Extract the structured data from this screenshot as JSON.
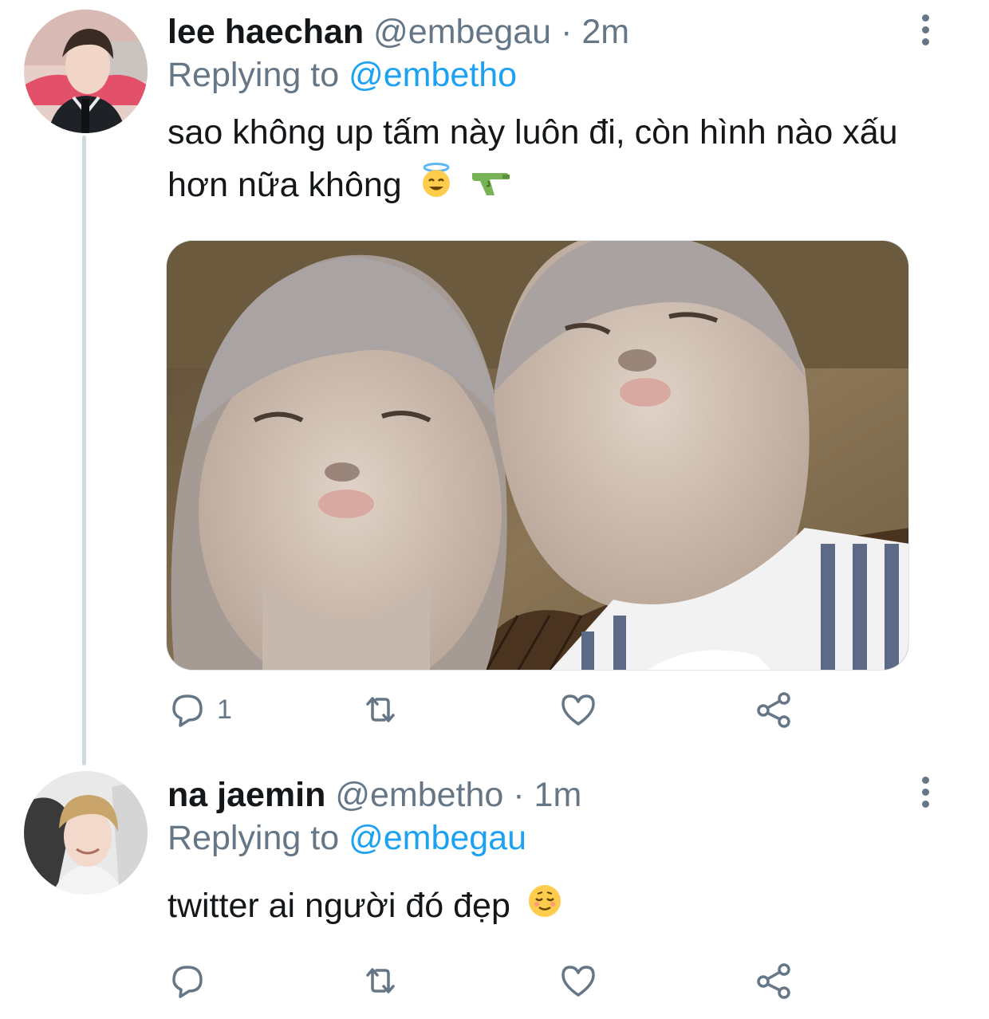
{
  "colors": {
    "text": "#14171a",
    "secondary": "#657786",
    "link": "#1da1f2",
    "line": "#cfd9de"
  },
  "tweets": [
    {
      "name": "lee haechan",
      "handle": "@embegau",
      "dot": "·",
      "time": "2m",
      "replying_prefix": "Replying to",
      "replying_to": "@embetho",
      "text": "sao không up tấm này luôn đi, còn hình nào xấu hơn nữa không",
      "emojis": [
        "smiling-face-with-halo",
        "water-pistol"
      ],
      "has_media": true,
      "actions": {
        "reply_count": "1",
        "retweet_count": "",
        "like_count": ""
      }
    },
    {
      "name": "na jaemin",
      "handle": "@embetho",
      "dot": "·",
      "time": "1m",
      "replying_prefix": "Replying to",
      "replying_to": "@embegau",
      "text": "twitter ai người đó đẹp",
      "emojis": [
        "relieved-face"
      ],
      "has_media": false,
      "actions": {
        "reply_count": "",
        "retweet_count": "",
        "like_count": ""
      }
    }
  ]
}
